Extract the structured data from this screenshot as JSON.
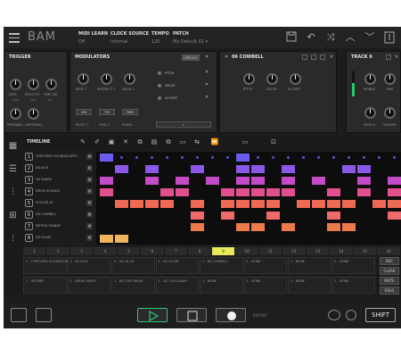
{
  "app": {
    "title": "BAM"
  },
  "header": {
    "fields": [
      {
        "key": "MIDI LEARN",
        "value": "Off"
      },
      {
        "key": "CLOCK SOURCE",
        "value": "Internal"
      },
      {
        "key": "TEMPO",
        "value": "120"
      },
      {
        "key": "PATCH",
        "value": "My Default 01 ▾"
      }
    ]
  },
  "trigger": {
    "title": "TRIGGER",
    "knobs": [
      "RATE",
      "VELOCITY",
      "TIME SIG",
      "PROBABIL...",
      "METRONO..."
    ],
    "values": [
      "1/16",
      "100",
      "4/4"
    ]
  },
  "modulators": {
    "title": "MODULATORS",
    "tag": "LFO 1 ▾",
    "knobs": [
      "RATE 1",
      "RESTRICT 1",
      "DELAY 1"
    ],
    "buttons": [
      "SIN",
      "TRI",
      "FREE"
    ],
    "bottom_labels": [
      "RESET 1",
      "SYNC 1",
      "PHASE..."
    ],
    "routes": [
      "PITCH",
      "DECAY",
      "ACCENT"
    ],
    "add": "+"
  },
  "instrument": {
    "title": "06 COWBELL",
    "knobs": [
      "PITCH",
      "DECAY",
      "ACCENT"
    ],
    "values": [
      "",
      "",
      ""
    ]
  },
  "track_panel": {
    "title": "TRACK 6",
    "knobs": [
      "MOBILE",
      "PAN",
      "SEND A",
      "VOLUME"
    ],
    "meter_level": 0.55
  },
  "timeline": {
    "title": "TIMELINE"
  },
  "tracks": [
    {
      "num": "1",
      "name": "TORTURED SOUNDSCAPES"
    },
    {
      "num": "2",
      "name": "DS KICK"
    },
    {
      "num": "3",
      "name": "DS SNARE"
    },
    {
      "num": "4",
      "name": "DRUM SOUNDS"
    },
    {
      "num": "5",
      "name": "FOOLED AT"
    },
    {
      "num": "6",
      "name": "DS COWBELL"
    },
    {
      "num": "7",
      "name": "METER CHANGE"
    },
    {
      "num": "8",
      "name": "DS HI-HAT"
    }
  ],
  "grid": {
    "colors": [
      "#6a5cf0",
      "#8a58e6",
      "#c44bc6",
      "#e0508f",
      "#ee6a52",
      "#f06a6a",
      "#ec7a4a",
      "#f0b45a"
    ],
    "rows": [
      [
        1,
        0,
        0,
        0,
        0,
        0,
        0,
        0,
        0,
        1,
        0,
        0,
        0,
        0,
        0,
        0,
        0,
        0,
        0,
        0
      ],
      [
        0,
        1,
        0,
        1,
        0,
        0,
        1,
        0,
        0,
        1,
        1,
        0,
        1,
        0,
        0,
        0,
        1,
        1,
        0,
        0
      ],
      [
        1,
        0,
        0,
        1,
        0,
        1,
        0,
        1,
        0,
        1,
        1,
        0,
        1,
        0,
        1,
        0,
        0,
        1,
        0,
        1
      ],
      [
        1,
        0,
        0,
        0,
        1,
        1,
        0,
        0,
        1,
        1,
        1,
        1,
        1,
        0,
        0,
        1,
        0,
        1,
        0,
        1
      ],
      [
        0,
        1,
        1,
        1,
        1,
        0,
        1,
        0,
        1,
        1,
        1,
        1,
        0,
        1,
        1,
        1,
        1,
        0,
        1,
        1
      ],
      [
        0,
        0,
        0,
        0,
        0,
        0,
        1,
        0,
        1,
        0,
        0,
        1,
        0,
        0,
        0,
        1,
        0,
        0,
        0,
        1
      ],
      [
        0,
        0,
        0,
        0,
        0,
        0,
        1,
        0,
        0,
        1,
        1,
        0,
        1,
        0,
        0,
        1,
        1,
        0,
        0,
        0
      ],
      [
        1,
        1,
        0,
        0,
        0,
        0,
        0,
        0,
        0,
        0,
        0,
        0,
        0,
        0,
        0,
        0,
        0,
        0,
        0,
        0
      ]
    ]
  },
  "steps": [
    "1",
    "2",
    "3",
    "4",
    "5",
    "6",
    "7",
    "8",
    "9",
    "10",
    "11",
    "12",
    "13",
    "14",
    "15",
    "16"
  ],
  "automation": {
    "lanes_top": [
      "1 - TORTURED SOUNDSCAPES",
      "2 - DS KICK",
      "3 - 4/5 DL AT",
      "1 - DS HI-HAT",
      "1 - DS COWBELL",
      "1 - NONE",
      "1 - NONE",
      "1 - NONE"
    ],
    "lanes_bottom": [
      "1 - REVERB",
      "1 - DRUM SYNTH",
      "1 - DS CYM CRASH",
      "1 - DS CYM CRASH",
      "1 - NONE",
      "1 - NONE",
      "1 - NONE",
      "1 - NONE"
    ],
    "side_buttons": [
      "REC",
      "CLEAR",
      "MUTE",
      "SOLO"
    ]
  },
  "bottom": {
    "export_label": "EXPORT",
    "shift_label": "SHIFT"
  }
}
